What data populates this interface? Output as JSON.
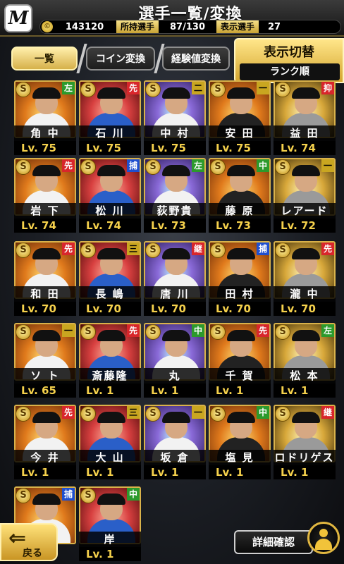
{
  "header": {
    "logo_letter": "M",
    "title": "選手一覧/変換",
    "coin_symbol": "©",
    "coins": "143120",
    "owned_label": "所持選手",
    "owned_value": "87/130",
    "display_label": "表示選手",
    "display_value": "27"
  },
  "tabs": [
    {
      "label": "一覧",
      "active": true
    },
    {
      "label": "コイン変換",
      "active": false
    },
    {
      "label": "経験値変換",
      "active": false
    }
  ],
  "display_toggle": {
    "title": "表示切替",
    "sort": "ランク順"
  },
  "players": [
    {
      "name": "角 中",
      "level": "Lv. 75",
      "pos": "左",
      "rank": "S"
    },
    {
      "name": "石 川",
      "level": "Lv. 75",
      "pos": "先",
      "rank": "S"
    },
    {
      "name": "中 村",
      "level": "Lv. 75",
      "pos": "二",
      "rank": "S"
    },
    {
      "name": "安 田",
      "level": "Lv. 75",
      "pos": "一",
      "rank": "S"
    },
    {
      "name": "益 田",
      "level": "Lv. 74",
      "pos": "抑",
      "rank": "S"
    },
    {
      "name": "岩 下",
      "level": "Lv. 74",
      "pos": "先",
      "rank": "S"
    },
    {
      "name": "松 川",
      "level": "Lv. 74",
      "pos": "捕",
      "rank": "S"
    },
    {
      "name": "荻野貴",
      "level": "Lv. 73",
      "pos": "左",
      "rank": "S"
    },
    {
      "name": "藤 原",
      "level": "Lv. 73",
      "pos": "中",
      "rank": "S"
    },
    {
      "name": "レアード",
      "level": "Lv. 72",
      "pos": "一",
      "rank": "S"
    },
    {
      "name": "和 田",
      "level": "Lv. 70",
      "pos": "先",
      "rank": "S"
    },
    {
      "name": "長 嶋",
      "level": "Lv. 70",
      "pos": "三",
      "rank": "S"
    },
    {
      "name": "唐 川",
      "level": "Lv. 70",
      "pos": "継",
      "rank": "S"
    },
    {
      "name": "田 村",
      "level": "Lv. 70",
      "pos": "捕",
      "rank": "S"
    },
    {
      "name": "瀧 中",
      "level": "Lv. 70",
      "pos": "先",
      "rank": "S"
    },
    {
      "name": "ソ ト",
      "level": "Lv. 65",
      "pos": "一",
      "rank": "S"
    },
    {
      "name": "斎藤隆",
      "level": "Lv. 1",
      "pos": "先",
      "rank": "S"
    },
    {
      "name": "丸",
      "level": "Lv. 1",
      "pos": "中",
      "rank": "S"
    },
    {
      "name": "千 賀",
      "level": "Lv. 1",
      "pos": "先",
      "rank": "S"
    },
    {
      "name": "松 本",
      "level": "Lv. 1",
      "pos": "左",
      "rank": "S"
    },
    {
      "name": "今 井",
      "level": "Lv. 1",
      "pos": "先",
      "rank": "S"
    },
    {
      "name": "大 山",
      "level": "Lv. 1",
      "pos": "三",
      "rank": "S"
    },
    {
      "name": "坂 倉",
      "level": "Lv. 1",
      "pos": "一",
      "rank": "S"
    },
    {
      "name": "塩 見",
      "level": "Lv. 1",
      "pos": "中",
      "rank": "S"
    },
    {
      "name": "ロドリゲス",
      "level": "Lv. 1",
      "pos": "継",
      "rank": "S"
    },
    {
      "name": "",
      "level": "",
      "pos": "捕",
      "rank": "S"
    },
    {
      "name": "岸",
      "level": "Lv. 1",
      "pos": "中",
      "rank": "S"
    }
  ],
  "footer": {
    "back_label": "戻る",
    "detail_label": "詳細確認"
  }
}
